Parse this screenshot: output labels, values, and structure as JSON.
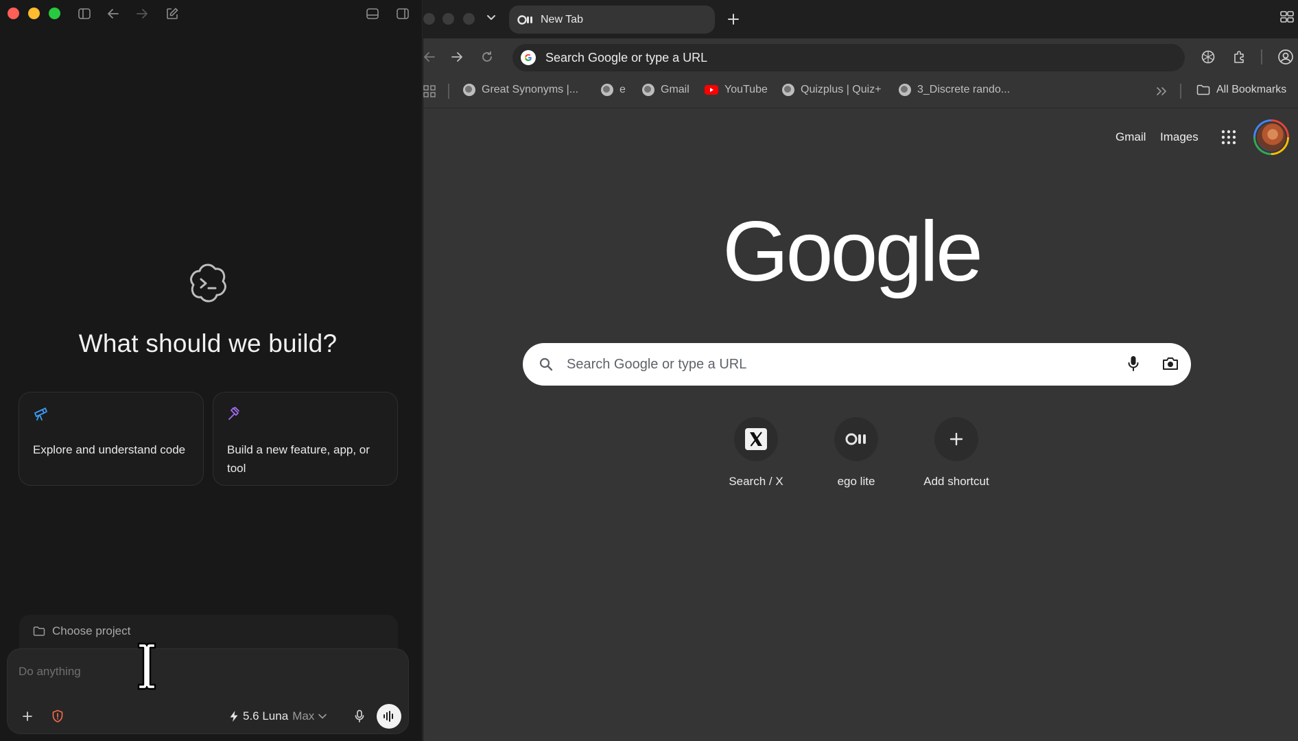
{
  "left_app": {
    "hero_title": "What should we build?",
    "cards": [
      {
        "icon": "telescope-icon",
        "label": "Explore and understand code"
      },
      {
        "icon": "hammer-icon",
        "label": "Build a new feature, app, or tool"
      }
    ],
    "choose_project": "Choose project",
    "prompt_placeholder": "Do anything",
    "model": {
      "name": "5.6 Luna",
      "tier": "Max"
    }
  },
  "browser": {
    "tab_title": "New Tab",
    "omnibox_text": "Search Google or type a URL",
    "bookmarks": [
      {
        "label": "Great Synonyms |...",
        "icon": "globe-icon"
      },
      {
        "label": "e",
        "icon": "globe-icon"
      },
      {
        "label": "Gmail",
        "icon": "globe-icon"
      },
      {
        "label": "YouTube",
        "icon": "youtube-icon"
      },
      {
        "label": "Quizplus | Quiz+",
        "icon": "globe-icon"
      },
      {
        "label": "3_Discrete rando...",
        "icon": "globe-icon"
      }
    ],
    "all_bookmarks": "All Bookmarks",
    "ntp": {
      "gmail_link": "Gmail",
      "images_link": "Images",
      "logo_text": "Google",
      "search_placeholder": "Search Google or type a URL",
      "shortcuts": [
        {
          "label": "Search / X",
          "icon": "x-logo-icon"
        },
        {
          "label": "ego lite",
          "icon": "ego-icon"
        },
        {
          "label": "Add shortcut",
          "icon": "plus-icon"
        }
      ]
    }
  },
  "colors": {
    "traffic_red": "#ff5f57",
    "traffic_yellow": "#febc2e",
    "traffic_green": "#28c840",
    "explore_icon": "#3b9df5",
    "build_icon": "#a26bf0",
    "shield_icon": "#ef6a4c"
  }
}
